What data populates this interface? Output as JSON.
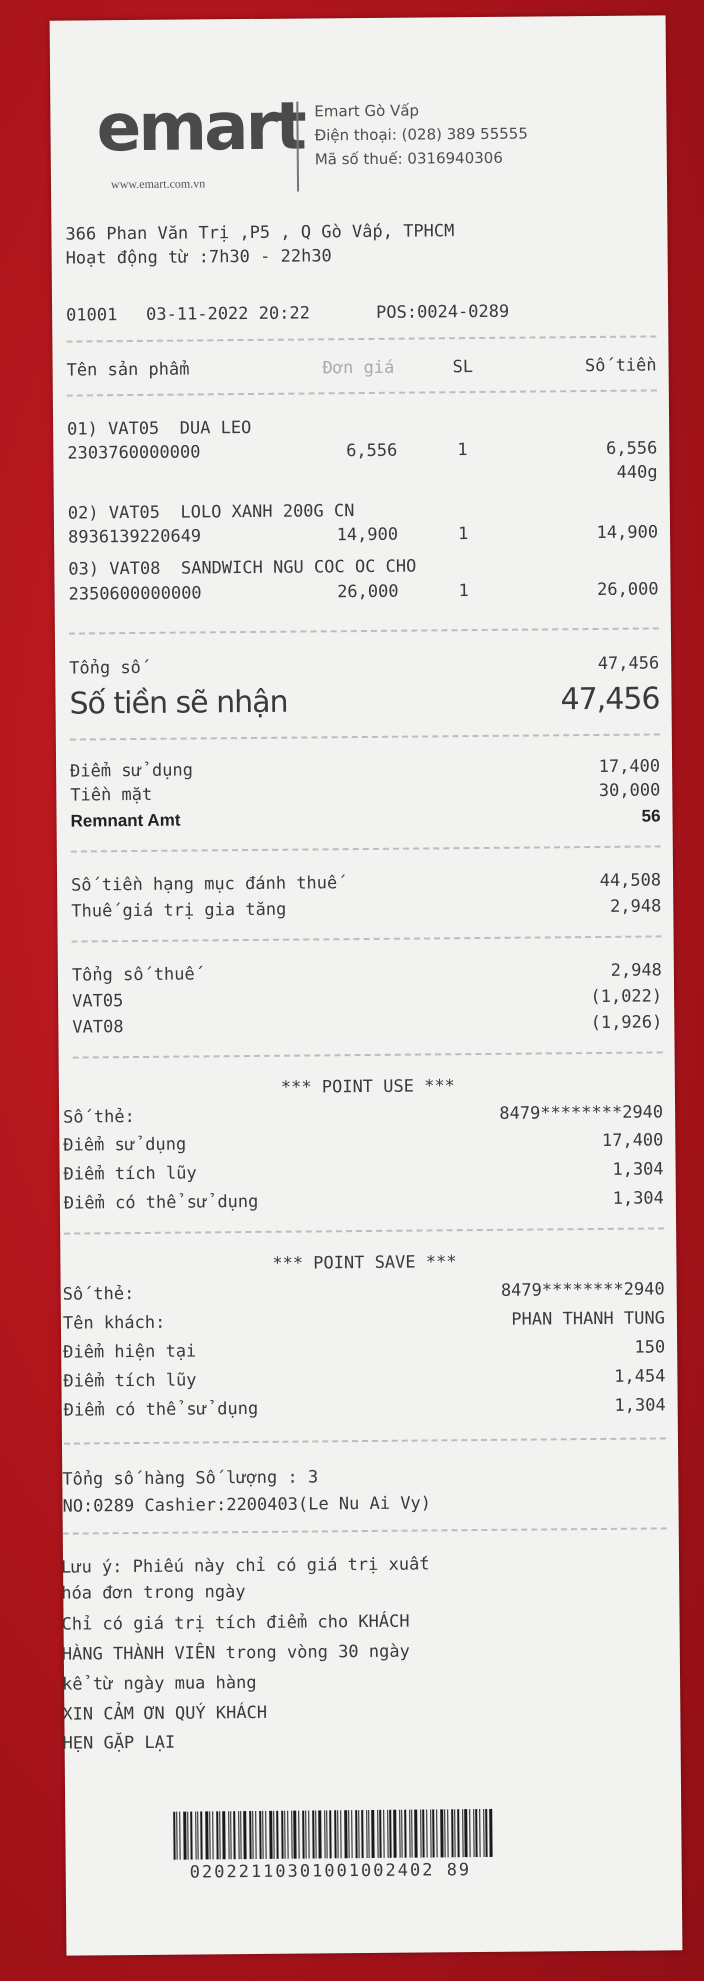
{
  "header": {
    "logo": "emart",
    "url": "www.emart.com.vn",
    "store_name": "Emart Gò Vấp",
    "phone": "Điện thoại: (028) 389 55555",
    "tax_code": "Mã số thuế: 0316940306",
    "address": "366 Phan Văn Trị ,P5 , Q Gò Vấp, TPHCM",
    "hours": "Hoạt động từ :7h30 - 22h30"
  },
  "transaction": {
    "store_code": "01001",
    "datetime": "03-11-2022 20:22",
    "pos": "POS:0024-0289"
  },
  "columns": {
    "name": "Tên sản phẩm",
    "price": "Đơn giá",
    "qty": "SL",
    "amount": "Số tiền"
  },
  "items": [
    {
      "line1": "01) VAT05  DUA LEO",
      "code": "2303760000000",
      "price": "6,556",
      "qty": "1",
      "amount": "6,556",
      "weight": "440g"
    },
    {
      "line1": "02) VAT05  LOLO XANH 200G CN",
      "code": "8936139220649",
      "price": "14,900",
      "qty": "1",
      "amount": "14,900"
    },
    {
      "line1": "03) VAT08  SANDWICH NGU COC OC CHO",
      "code": "2350600000000",
      "price": "26,000",
      "qty": "1",
      "amount": "26,000"
    }
  ],
  "totals": {
    "total_label": "Tổng số",
    "total_value": "47,456",
    "receive_label": "Số tiền sẽ nhận",
    "receive_value": "47,456",
    "points_used_label": "Điểm sử dụng",
    "points_used_value": "17,400",
    "cash_label": "Tiền mặt",
    "cash_value": "30,000",
    "remnant_label": "Remnant Amt",
    "remnant_value": "56"
  },
  "tax": {
    "taxable_label": "Số tiền hạng mục đánh thuế",
    "taxable_value": "44,508",
    "vat_label": "Thuế giá trị gia tăng",
    "vat_value": "2,948",
    "tax_total_label": "Tổng số thuế",
    "tax_total_value": "2,948",
    "vat05_label": "VAT05",
    "vat05_value": "(1,022)",
    "vat08_label": "VAT08",
    "vat08_value": "(1,926)"
  },
  "point_use": {
    "title": "*** POINT USE ***",
    "card_label": "Số thẻ:",
    "card_value": "8479********2940",
    "used_label": "Điểm sử dụng",
    "used_value": "17,400",
    "accum_label": "Điểm tích lũy",
    "accum_value": "1,304",
    "avail_label": "Điểm có thể sử dụng",
    "avail_value": "1,304"
  },
  "point_save": {
    "title": "*** POINT SAVE ***",
    "card_label": "Số thẻ:",
    "card_value": "8479********2940",
    "name_label": "Tên khách:",
    "name_value": "PHAN THANH TUNG",
    "current_label": "Điểm hiện tại",
    "current_value": "150",
    "accum_label": "Điểm tích lũy",
    "accum_value": "1,454",
    "avail_label": "Điểm có thể sử dụng",
    "avail_value": "1,304"
  },
  "footer": {
    "qty_line": "Tổng số hàng Số lượng : 3",
    "cashier_line": "NO:0289 Cashier:2200403(Le Nu Ai Vy)",
    "note1": "Lưu ý: Phiếu này chỉ có giá trị xuất",
    "note2": "hóa đơn trong ngày",
    "note3": "Chỉ có giá trị tích điểm cho KHÁCH",
    "note4": "HÀNG THÀNH VIÊN trong vòng 30 ngày",
    "note5": "kể từ ngày mua hàng",
    "note6": "XIN CẢM ƠN QUÝ KHÁCH",
    "note7": "HẸN GẶP LẠI",
    "barcode_number": "02022110301001002402 89"
  }
}
